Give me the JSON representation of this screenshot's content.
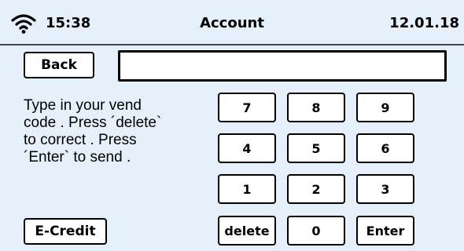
{
  "status_bar": {
    "time": "15:38",
    "title": "Account",
    "date": "12.01.18",
    "wifi_icon": "wifi-icon"
  },
  "back_label": "Back",
  "code_input": {
    "value": ""
  },
  "instructions": "Type in your vend\ncode . Press ´delete`\nto correct . Press\n´Enter` to send .",
  "keypad": {
    "rows": [
      [
        "7",
        "8",
        "9"
      ],
      [
        "4",
        "5",
        "6"
      ],
      [
        "1",
        "2",
        "3"
      ],
      [
        "delete",
        "0",
        "Enter"
      ]
    ]
  },
  "ecredit_label": "E-Credit",
  "colors": {
    "background": "#e6f0fa",
    "button_fill": "#ffffff",
    "border": "#000000",
    "divider": "#3a4a58"
  }
}
